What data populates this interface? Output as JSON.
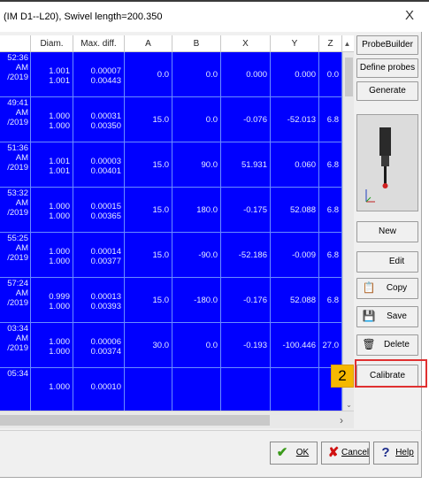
{
  "window": {
    "title": "(IM D1--L20), Swivel length=200.350",
    "close_glyph": "X"
  },
  "grid": {
    "columns": [
      "",
      "Diam.",
      "Max. diff.",
      "A",
      "B",
      "X",
      "Y",
      "Z"
    ],
    "rows": [
      {
        "date": [
          "52:36",
          "AM",
          "/2019"
        ],
        "diam": [
          "1.001",
          "1.001"
        ],
        "maxdiff": [
          "0.00007",
          "0.00443"
        ],
        "a": "0.0",
        "b": "0.0",
        "x": "0.000",
        "y": "0.000",
        "z": "0.0"
      },
      {
        "date": [
          "49:41",
          "AM",
          "/2019"
        ],
        "diam": [
          "1.000",
          "1.000"
        ],
        "maxdiff": [
          "0.00031",
          "0.00350"
        ],
        "a": "15.0",
        "b": "0.0",
        "x": "-0.076",
        "y": "-52.013",
        "z": "6.8"
      },
      {
        "date": [
          "51:36",
          "AM",
          "/2019"
        ],
        "diam": [
          "1.001",
          "1.001"
        ],
        "maxdiff": [
          "0.00003",
          "0.00401"
        ],
        "a": "15.0",
        "b": "90.0",
        "x": "51.931",
        "y": "0.060",
        "z": "6.8"
      },
      {
        "date": [
          "53:32",
          "AM",
          "/2019"
        ],
        "diam": [
          "1.000",
          "1.000"
        ],
        "maxdiff": [
          "0.00015",
          "0.00365"
        ],
        "a": "15.0",
        "b": "180.0",
        "x": "-0.175",
        "y": "52.088",
        "z": "6.8"
      },
      {
        "date": [
          "55:25",
          "AM",
          "/2019"
        ],
        "diam": [
          "1.000",
          "1.000"
        ],
        "maxdiff": [
          "0.00014",
          "0.00377"
        ],
        "a": "15.0",
        "b": "-90.0",
        "x": "-52.186",
        "y": "-0.009",
        "z": "6.8"
      },
      {
        "date": [
          "57:24",
          "AM",
          "/2019"
        ],
        "diam": [
          "0.999",
          "1.000"
        ],
        "maxdiff": [
          "0.00013",
          "0.00393"
        ],
        "a": "15.0",
        "b": "-180.0",
        "x": "-0.176",
        "y": "52.088",
        "z": "6.8"
      },
      {
        "date": [
          "03:34",
          "AM",
          "/2019"
        ],
        "diam": [
          "1.000",
          "1.000"
        ],
        "maxdiff": [
          "0.00006",
          "0.00374"
        ],
        "a": "30.0",
        "b": "0.0",
        "x": "-0.193",
        "y": "-100.446",
        "z": "27.0"
      },
      {
        "date": [
          "05:34",
          "",
          ""
        ],
        "diam": [
          "1.000",
          ""
        ],
        "maxdiff": [
          "0.00010",
          ""
        ],
        "a": "",
        "b": "",
        "x": "",
        "y": "",
        "z": ""
      }
    ]
  },
  "side_buttons": {
    "probebuilder": "ProbeBuilder",
    "define_probes": "Define probes",
    "generate": "Generate",
    "new": "New",
    "edit": "Edit",
    "copy": "Copy",
    "save": "Save",
    "delete": "Delete",
    "calibrate": "Calibrate"
  },
  "callout": {
    "number": "2",
    "color": "#f5b800",
    "highlight": "#e03030"
  },
  "footer": {
    "ok": "OK",
    "cancel": "Cancel",
    "help": "Help"
  },
  "colors": {
    "grid_background": "#0000ff",
    "grid_text": "#e6ecff"
  }
}
